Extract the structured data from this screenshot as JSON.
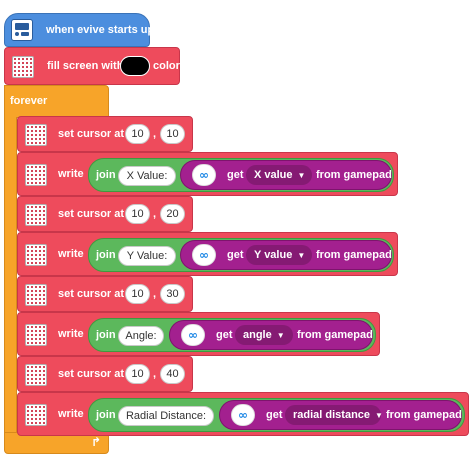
{
  "hat": {
    "label": "when evive starts up",
    "icon": "evive-board-icon"
  },
  "fill": {
    "prefix": "fill screen with",
    "suffix": "color",
    "color": "#000000"
  },
  "forever": {
    "label": "forever",
    "loop_icon": "loop-arrow-icon"
  },
  "cursor_label": "set cursor at",
  "write_label": "write",
  "join_label": "join",
  "get_label": "get",
  "from_label": "from gamepad",
  "comma": ",",
  "cursors": [
    {
      "x": "10",
      "y": "10"
    },
    {
      "x": "10",
      "y": "20"
    },
    {
      "x": "10",
      "y": "30"
    },
    {
      "x": "10",
      "y": "40"
    }
  ],
  "writes": [
    {
      "text": "X Value:",
      "param": "X value"
    },
    {
      "text": "Y Value:",
      "param": "Y value"
    },
    {
      "text": "Angle:",
      "param": "angle"
    },
    {
      "text": "Radial Distance:",
      "param": "radial distance"
    }
  ],
  "colors": {
    "display": "#ee4b5c",
    "control": "#f7a429",
    "event": "#4c8ede",
    "operator": "#5cb85c",
    "gamepad": "#a3208f"
  }
}
